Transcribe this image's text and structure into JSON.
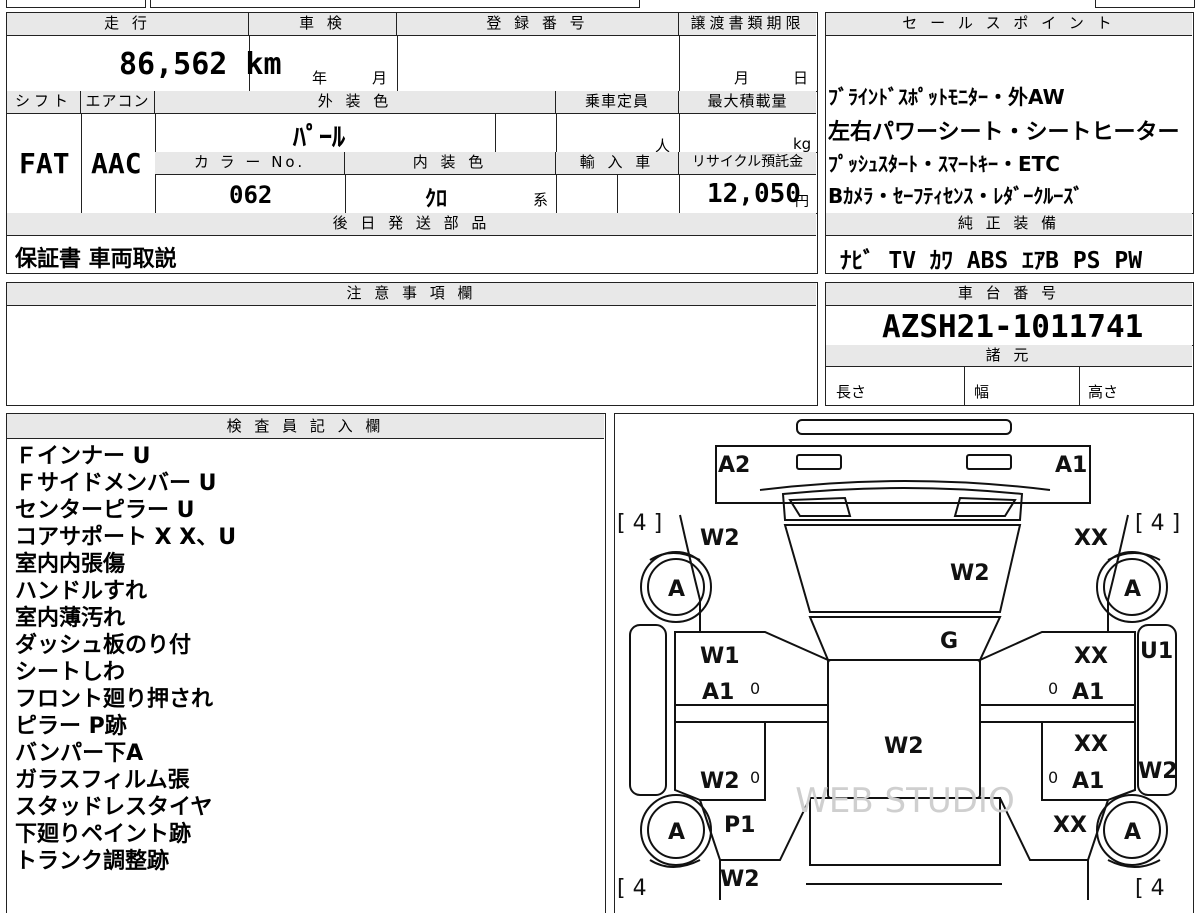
{
  "header": {
    "mileage_label": "走 行",
    "inspection_label": "車 検",
    "registration_label": "登 録 番 号",
    "transfer_deadline_label": "譲渡書類期限",
    "mileage_value": "86,562 km",
    "year_unit": "年",
    "month_unit": "月",
    "deadline_month": "月",
    "deadline_day": "日"
  },
  "specs": {
    "shift_label": "シフト",
    "aircon_label": "エアコン",
    "ext_color_label": "外 装 色",
    "capacity_label": "乗車定員",
    "max_load_label": "最大積載量",
    "shift_value": "FAT",
    "aircon_value": "AAC",
    "ext_color_value": "ﾊﾟｰﾙ",
    "capacity_unit": "人",
    "load_unit": "kg",
    "color_no_label": "カ ラ ー No.",
    "int_color_label": "内 装 色",
    "import_label": "輸 入 車",
    "recycle_label": "リサイクル預託金",
    "color_no_value": "062",
    "int_color_value": "ｸﾛ",
    "int_color_suffix": "系",
    "recycle_value": "12,050",
    "recycle_unit": "円"
  },
  "later_parts": {
    "label": "後 日 発 送 部 品",
    "value": "保証書 車両取説"
  },
  "notes": {
    "label": "注 意 事 項 欄"
  },
  "sales_points": {
    "label": "セ ー ル ス ポ イ ン ト",
    "lines": [
      "ﾌﾞﾗｲﾝﾄﾞｽﾎﾟｯﾄﾓﾆﾀｰ・外AW",
      "左右パワーシート・シートヒーター",
      "ﾌﾟｯｼｭｽﾀｰﾄ・ｽﾏｰﾄｷｰ・ETC",
      "Bｶﾒﾗ・ｾｰﾌﾃｨｾﾝｽ・ﾚﾀﾞｰｸﾙｰｽﾞ"
    ]
  },
  "equipment": {
    "label": "純 正 装 備",
    "value": "ﾅﾋﾞ TV ｶﾜ ABS ｴｱB PS PW"
  },
  "chassis": {
    "label": "車 台 番 号",
    "value": "AZSH21-1011741"
  },
  "dimensions": {
    "label": "諸 元",
    "length_label": "長さ",
    "width_label": "幅",
    "height_label": "高さ"
  },
  "inspector": {
    "label": "検 査 員 記 入 欄",
    "items": [
      "Ｆインナー U",
      "Ｆサイドメンバー U",
      "センターピラー U",
      "コアサポート X X、U",
      "室内内張傷",
      "ハンドルすれ",
      "室内薄汚れ",
      "ダッシュ板のり付",
      "シートしわ",
      "フロント廻り押され",
      "ピラー P跡",
      "バンパー下A",
      "ガラスフィルム張",
      "スタッドレスタイヤ",
      "下廻りペイント跡",
      "トランク調整跡"
    ]
  },
  "diagram": {
    "labels": {
      "front_left_corner": "A2",
      "front_right_corner": "A1",
      "left_fender": "W2",
      "right_fender": "XX",
      "hood": "W2",
      "windshield": "G",
      "left_front_door_1": "W1",
      "left_front_door_2": "A1",
      "right_front_door_1": "XX",
      "right_front_door_2": "A1",
      "roof": "W2",
      "left_rear_door": "W2",
      "right_rear_door_1": "XX",
      "right_rear_door_2": "A1",
      "right_pillar_top": "U1",
      "right_pillar_bottom": "W2",
      "left_quarter": "P1",
      "right_quarter": "XX",
      "left_rear": "W2",
      "tire_fl": "A",
      "tire_fr": "A",
      "tire_rl": "A",
      "tire_rr": "A",
      "tread_fl": "[ 4 ]",
      "tread_fr": "[ 4 ]",
      "tread_rl": "[ 4",
      "tread_rr": "[ 4",
      "zero_1": "0",
      "zero_2": "0",
      "zero_3": "0",
      "zero_4": "0"
    },
    "watermark": "WEB STUDIO"
  }
}
